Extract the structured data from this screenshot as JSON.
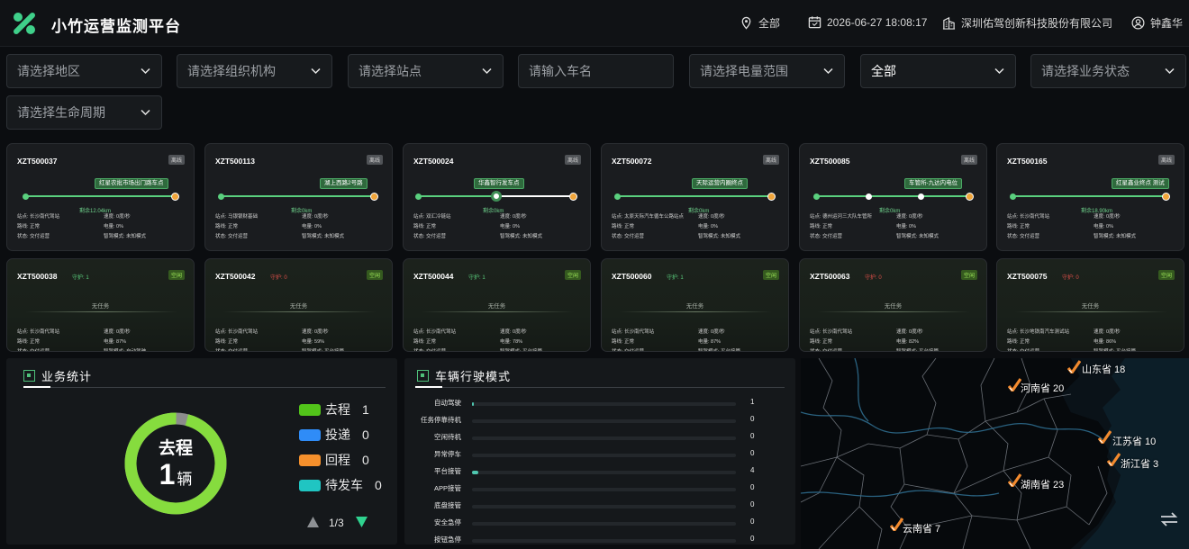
{
  "app": {
    "title": "小竹运营监测平台"
  },
  "header": {
    "region": "全部",
    "datetime": "2026-06-27 18:08:17",
    "company": "深圳佑驾创新科技股份有限公司",
    "user": "钟鑫华"
  },
  "filters": {
    "region": "请选择地区",
    "org": "请选择组织机构",
    "station": "请选择站点",
    "plate_placeholder": "请输入车名",
    "battery": "请选择电量范围",
    "all": "全部",
    "biz_status": "请选择业务状态",
    "lifecycle": "请选择生命周期"
  },
  "vehicles_active": [
    {
      "id": "XZT500037",
      "badge": "离线",
      "stop": "红星农批市场出门路车点",
      "remain": "剩余12.04km",
      "r1a": "站点: 长沙南代驾站",
      "r1b": "速度: 0度/秒",
      "r2a": "路线: 正常",
      "r2b": "电量: 0%",
      "r3a": "状态: 交付运营",
      "r3b": "智驾模式: 未知模式"
    },
    {
      "id": "XZT500113",
      "badge": "离线",
      "stop": "湖上西路2号路",
      "remain": "剩余0km",
      "r1a": "站点: 马银银财基础",
      "r1b": "速度: 0度/秒",
      "r2a": "路线: 正常",
      "r2b": "电量: 0%",
      "r3a": "状态: 交付运营",
      "r3b": "智驾模式: 未知模式"
    },
    {
      "id": "XZT500024",
      "badge": "离线",
      "stop": "华鑫智行发车点",
      "remain": "剩余0km",
      "r1a": "站点: 双汇冷链站",
      "r1b": "速度: 0度/秒",
      "r2a": "路线: 正常",
      "r2b": "电量: 0%",
      "r3a": "状态: 交付运营",
      "r3b": "智驾模式: 未知模式"
    },
    {
      "id": "XZT500072",
      "badge": "离线",
      "stop": "天际运营内圈终点",
      "remain": "剩余0km",
      "r1a": "站点: 太原天际汽车循车公路站点",
      "r1b": "速度: 0度/秒",
      "r2a": "路线: 正常",
      "r2b": "电量: 0%",
      "r3a": "状态: 交付运营",
      "r3b": "智驾模式: 未知模式"
    },
    {
      "id": "XZT500085",
      "badge": "离线",
      "stop": "车管所-九达内电位",
      "remain": "剩余0km",
      "r1a": "站点: 德州运河三大队车管所",
      "r1b": "速度: 0度/秒",
      "r2a": "路线: 正常",
      "r2b": "电量: 0%",
      "r3a": "状态: 交付运营",
      "r3b": "智驾模式: 未知模式"
    },
    {
      "id": "XZT500165",
      "badge": "离线",
      "stop": "红星鑫业终点 测试",
      "remain": "剩余18.90km",
      "r1a": "站点: 长沙南代驾站",
      "r1b": "速度: 0度/秒",
      "r2a": "路线: 正常",
      "r2b": "电量: 0%",
      "r3a": "状态: 交付运营",
      "r3b": "智驾模式: 未知模式"
    }
  ],
  "vehicles_idle": [
    {
      "id": "XZT500038",
      "mark": "守护: 1",
      "mark_color": "#5ad07e",
      "badge": "空闲",
      "notask": "无任务",
      "r1a": "站点: 长沙南代驾站",
      "r1b": "速度: 0度/秒",
      "r2a": "路线: 正常",
      "r2b": "电量: 87%",
      "r3a": "状态: 交付运营",
      "r3b": "智驾模式: 自动驾驶"
    },
    {
      "id": "XZT500042",
      "mark": "守护: 0",
      "mark_color": "#e0504a",
      "badge": "空闲",
      "notask": "无任务",
      "r1a": "站点: 长沙南代驾站",
      "r1b": "速度: 0度/秒",
      "r2a": "路线: 正常",
      "r2b": "电量: 59%",
      "r3a": "状态: 交付运营",
      "r3b": "智驾模式: 平台接管"
    },
    {
      "id": "XZT500044",
      "mark": "守护: 1",
      "mark_color": "#5ad07e",
      "badge": "空闲",
      "notask": "无任务",
      "r1a": "站点: 长沙南代驾站",
      "r1b": "速度: 0度/秒",
      "r2a": "路线: 正常",
      "r2b": "电量: 78%",
      "r3a": "状态: 交付运营",
      "r3b": "智驾模式: 平台接管"
    },
    {
      "id": "XZT500060",
      "mark": "守护: 1",
      "mark_color": "#5ad07e",
      "badge": "空闲",
      "notask": "无任务",
      "r1a": "站点: 长沙南代驾站",
      "r1b": "速度: 0度/秒",
      "r2a": "路线: 正常",
      "r2b": "电量: 87%",
      "r3a": "状态: 交付运营",
      "r3b": "智驾模式: 平台接管"
    },
    {
      "id": "XZT500063",
      "mark": "守护: 0",
      "mark_color": "#e0504a",
      "badge": "空闲",
      "notask": "无任务",
      "r1a": "站点: 长沙南代驾站",
      "r1b": "速度: 0度/秒",
      "r2a": "路线: 正常",
      "r2b": "电量: 82%",
      "r3a": "状态: 交付运营",
      "r3b": "智驾模式: 平台接管"
    },
    {
      "id": "XZT500075",
      "mark": "守护: 0",
      "mark_color": "#e0504a",
      "badge": "空闲",
      "notask": "无任务",
      "r1a": "站点: 长沙地铁南汽车测试站",
      "r1b": "速度: 0度/秒",
      "r2a": "路线: 正常",
      "r2b": "电量: 86%",
      "r3a": "状态: 交付运营",
      "r3b": "智驾模式: 平台接管"
    }
  ],
  "business": {
    "title": "业务统计",
    "center_label": "去程",
    "center_value": "1",
    "center_unit": "辆",
    "progress": 0.04,
    "legend": [
      {
        "label": "去程",
        "value": "1",
        "color": "#52c41a"
      },
      {
        "label": "投递",
        "value": "0",
        "color": "#2f8cf7"
      },
      {
        "label": "回程",
        "value": "0",
        "color": "#f5902c"
      },
      {
        "label": "待发车",
        "value": "0",
        "color": "#20c5c2"
      }
    ],
    "page": "1/3"
  },
  "drive_mode": {
    "title": "车辆行驶模式",
    "rows": [
      {
        "label": "自动驾驶",
        "value": 1
      },
      {
        "label": "任务停靠待机",
        "value": 0
      },
      {
        "label": "空闲待机",
        "value": 0
      },
      {
        "label": "异常停车",
        "value": 0
      },
      {
        "label": "平台接管",
        "value": 4
      },
      {
        "label": "APP接管",
        "value": 0
      },
      {
        "label": "底盘接管",
        "value": 0
      },
      {
        "label": "安全急停",
        "value": 0
      },
      {
        "label": "按钮急停",
        "value": 0
      }
    ],
    "max": 160
  },
  "map": {
    "provinces": [
      {
        "name": "山东省 18"
      },
      {
        "name": "河南省 20"
      },
      {
        "name": "江苏省 10"
      },
      {
        "name": "浙江省 3"
      },
      {
        "name": "湖南省 23"
      },
      {
        "name": "云南省 7"
      }
    ]
  }
}
